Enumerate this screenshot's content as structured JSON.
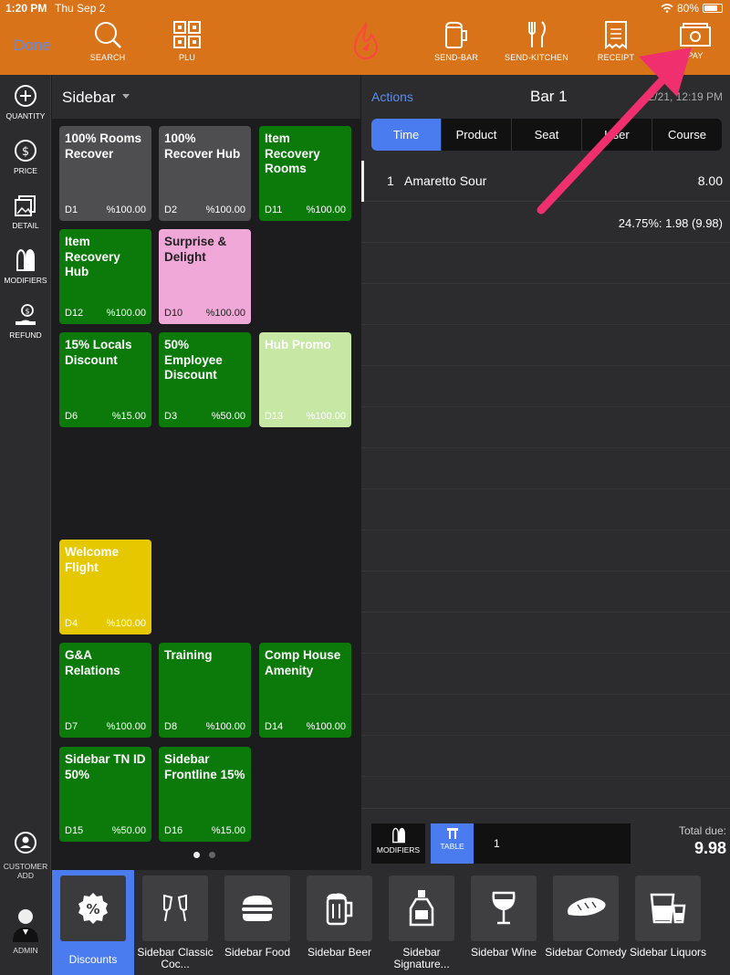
{
  "status": {
    "time": "1:20 PM",
    "date": "Thu Sep 2",
    "battery": "80%"
  },
  "toolbar": {
    "done": "Done",
    "search": "SEARCH",
    "plu": "PLU",
    "send_bar": "SEND-BAR",
    "send_kitchen": "SEND-KITCHEN",
    "receipt": "RECEIPT",
    "pay": "PAY"
  },
  "rail": {
    "quantity": "QUANTITY",
    "price": "PRICE",
    "detail": "DETAIL",
    "modifiers": "MODIFIERS",
    "refund": "REFUND",
    "customer_add_1": "CUSTOMER",
    "customer_add_2": "ADD",
    "admin": "ADMIN"
  },
  "discounts": {
    "header": "Sidebar",
    "tiles": [
      {
        "name": "100% Rooms Recover",
        "code": "D1",
        "pct": "%100.00"
      },
      {
        "name": "100% Recover Hub",
        "code": "D2",
        "pct": "%100.00"
      },
      {
        "name": "Item Recovery Rooms",
        "code": "D11",
        "pct": "%100.00"
      },
      {
        "name": "Item Recovery Hub",
        "code": "D12",
        "pct": "%100.00"
      },
      {
        "name": "Surprise & Delight",
        "code": "D10",
        "pct": "%100.00"
      },
      {
        "name": "15% Locals Discount",
        "code": "D6",
        "pct": "%15.00"
      },
      {
        "name": "50% Employee Discount",
        "code": "D3",
        "pct": "%50.00"
      },
      {
        "name": "Hub Promo",
        "code": "D13",
        "pct": "%100.00"
      },
      {
        "name": "Welcome Flight",
        "code": "D4",
        "pct": "%100.00"
      },
      {
        "name": "G&A Relations",
        "code": "D7",
        "pct": "%100.00"
      },
      {
        "name": "Training",
        "code": "D8",
        "pct": "%100.00"
      },
      {
        "name": "Comp House Amenity",
        "code": "D14",
        "pct": "%100.00"
      },
      {
        "name": "Sidebar TN ID 50%",
        "code": "D15",
        "pct": "%50.00"
      },
      {
        "name": "Sidebar Frontline 15%",
        "code": "D16",
        "pct": "%15.00"
      }
    ]
  },
  "order": {
    "actions": "Actions",
    "title": "Bar 1",
    "date": "2/21, 12:19 PM",
    "tabs": [
      "Time",
      "Product",
      "Seat",
      "User",
      "Course"
    ],
    "active_tab": "Time",
    "line": {
      "qty": "1",
      "item": "Amaretto Sour",
      "amount": "8.00"
    },
    "tax": "24.75%: 1.98 (9.98)",
    "footer": {
      "modifiers": "MODIFIERS",
      "table": "TABLE",
      "table_number": "1",
      "total_label": "Total due:",
      "total": "9.98"
    }
  },
  "categories": [
    {
      "label": "Discounts"
    },
    {
      "label": "Sidebar Classic Coc..."
    },
    {
      "label": "Sidebar Food"
    },
    {
      "label": "Sidebar Beer"
    },
    {
      "label": "Sidebar Signature..."
    },
    {
      "label": "Sidebar Wine"
    },
    {
      "label": "Sidebar Comedy"
    },
    {
      "label": "Sidebar Liquors"
    }
  ],
  "colors": {
    "toolbar": "#d9731a",
    "accent": "#4a7cf0",
    "tile_green": "#0b7a0b",
    "tile_gray": "#4e4e50",
    "tile_pink": "#f0a8d8",
    "tile_lightgreen": "#c6e8a4",
    "tile_yellow": "#e6c800",
    "annotation_arrow": "#f0306e"
  }
}
